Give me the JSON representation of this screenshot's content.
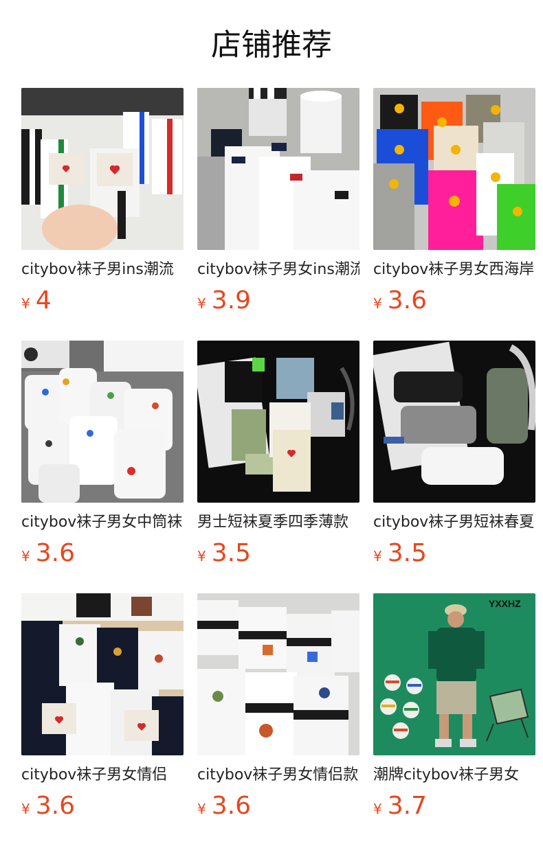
{
  "header": {
    "title": "店铺推荐"
  },
  "colors": {
    "price": "#e8461d",
    "text": "#222222",
    "background": "#ffffff"
  },
  "products": [
    {
      "name": "citybov袜子男ins潮流",
      "currency": "¥",
      "price": "4",
      "image": "white crew socks with colored stripes and heart labels held in hand"
    },
    {
      "name": "citybov袜子男女ins潮流",
      "currency": "¥",
      "price": "3.9",
      "image": "white and grey ankle socks with label tags beside paper cups"
    },
    {
      "name": "citybov袜子男女西海岸",
      "currency": "¥",
      "price": "3.6",
      "image": "colorful ribbed socks with embroidered campfire patch"
    },
    {
      "name": "citybov袜子男女中筒袜",
      "currency": "¥",
      "price": "3.6",
      "image": "white socks with small embroidered figures"
    },
    {
      "name": "男士短袜夏季四季薄款",
      "currency": "¥",
      "price": "3.5",
      "image": "assorted low-cut socks on black background"
    },
    {
      "name": "citybov袜子男短袜春夏",
      "currency": "¥",
      "price": "3.5",
      "image": "black grey olive white ankle socks on black background"
    },
    {
      "name": "citybov袜子男女情侣",
      "currency": "¥",
      "price": "3.6",
      "image": "navy and white ankle socks with embroidered patches"
    },
    {
      "name": "citybov袜子男女情侣款",
      "currency": "¥",
      "price": "3.6",
      "image": "white ankle socks with black cuffs and embroidered patches"
    },
    {
      "name": "潮牌citybov袜子男女",
      "currency": "¥",
      "price": "3.7",
      "image": "model in green tee on green background with sock patches",
      "brand_text": "YXXHZ"
    }
  ]
}
